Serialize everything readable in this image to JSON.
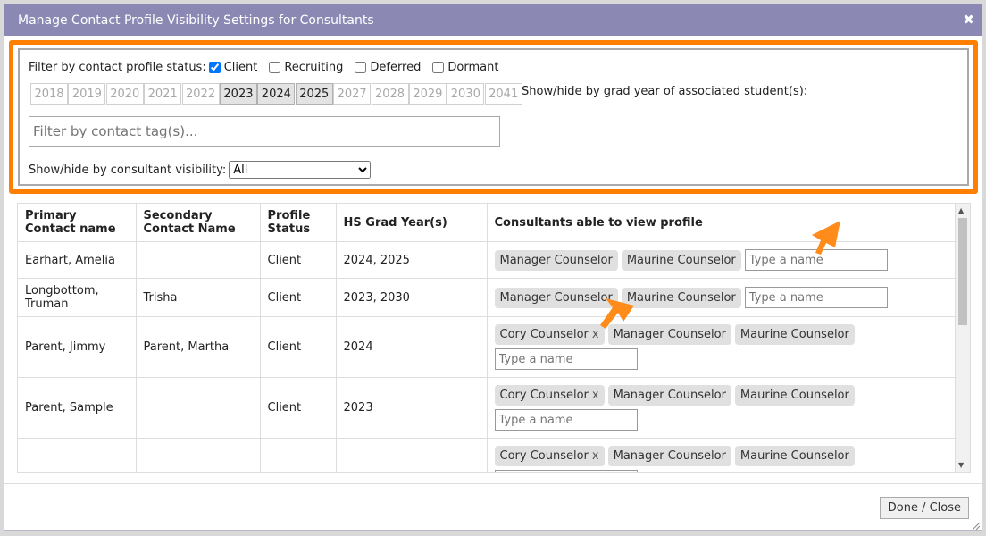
{
  "dialog": {
    "title": "Manage Contact Profile Visibility Settings for Consultants",
    "close_glyph": "✖"
  },
  "filters": {
    "status_label": "Filter by contact profile status:",
    "statuses": [
      {
        "label": "Client",
        "checked": true
      },
      {
        "label": "Recruiting",
        "checked": false
      },
      {
        "label": "Deferred",
        "checked": false
      },
      {
        "label": "Dormant",
        "checked": false
      }
    ],
    "years": [
      {
        "label": "2018",
        "on": false
      },
      {
        "label": "2019",
        "on": false
      },
      {
        "label": "2020",
        "on": false
      },
      {
        "label": "2021",
        "on": false
      },
      {
        "label": "2022",
        "on": false
      },
      {
        "label": "2023",
        "on": true
      },
      {
        "label": "2024",
        "on": true
      },
      {
        "label": "2025",
        "on": true
      },
      {
        "label": "2027",
        "on": false
      },
      {
        "label": "2028",
        "on": false
      },
      {
        "label": "2029",
        "on": false
      },
      {
        "label": "2030",
        "on": false
      },
      {
        "label": "2041",
        "on": false
      }
    ],
    "years_label": "Show/hide by grad year of associated student(s):",
    "tag_placeholder": "Filter by contact tag(s)...",
    "visibility_label": "Show/hide by consultant visibility:",
    "visibility_value": "All"
  },
  "table": {
    "headers": [
      "Primary Contact name",
      "Secondary Contact Name",
      "Profile Status",
      "HS Grad Year(s)",
      "Consultants able to view profile"
    ],
    "name_placeholder": "Type a name",
    "rows": [
      {
        "primary": "Earhart, Amelia",
        "secondary": "",
        "status": "Client",
        "years": "2024, 2025",
        "consultants": [
          {
            "name": "Manager Counselor",
            "x": false
          },
          {
            "name": "Maurine Counselor",
            "x": false
          }
        ]
      },
      {
        "primary": "Longbottom, Truman",
        "secondary": "Trisha",
        "status": "Client",
        "years": "2023, 2030",
        "consultants": [
          {
            "name": "Manager Counselor",
            "x": false
          },
          {
            "name": "Maurine Counselor",
            "x": false
          }
        ]
      },
      {
        "primary": "Parent, Jimmy",
        "secondary": "Parent, Martha",
        "status": "Client",
        "years": "2024",
        "consultants": [
          {
            "name": "Cory Counselor",
            "x": true
          },
          {
            "name": "Manager Counselor",
            "x": false
          },
          {
            "name": "Maurine Counselor",
            "x": false
          }
        ]
      },
      {
        "primary": "Parent, Sample",
        "secondary": "",
        "status": "Client",
        "years": "2023",
        "consultants": [
          {
            "name": "Cory Counselor",
            "x": true
          },
          {
            "name": "Manager Counselor",
            "x": false
          },
          {
            "name": "Maurine Counselor",
            "x": false
          }
        ]
      },
      {
        "primary": "",
        "secondary": "",
        "status": "",
        "years": "",
        "consultants": [
          {
            "name": "Cory Counselor",
            "x": true
          },
          {
            "name": "Manager Counselor",
            "x": false
          },
          {
            "name": "Maurine Counselor",
            "x": false
          }
        ]
      }
    ]
  },
  "footer": {
    "done_label": "Done / Close"
  },
  "colors": {
    "title_bar": "#8b89b4",
    "highlight": "#ff7f00"
  },
  "icons": {
    "close": "close-icon",
    "arrow": "arrow-pointer-icon"
  }
}
